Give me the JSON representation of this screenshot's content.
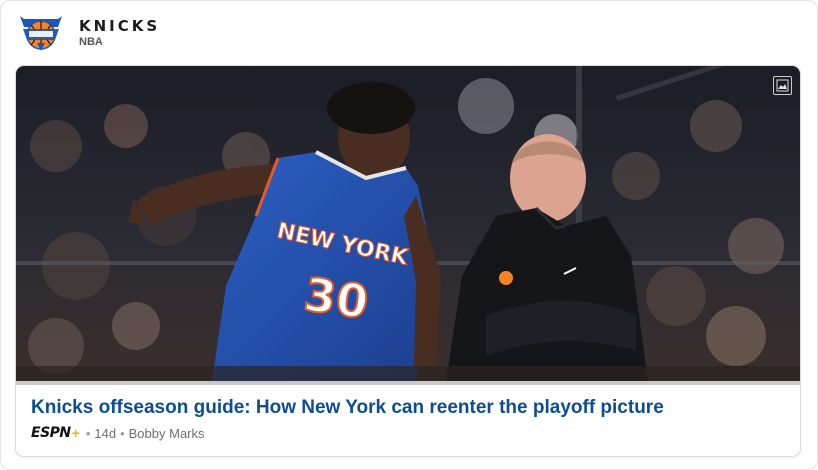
{
  "header": {
    "team_name": "KNICKS",
    "league": "NBA",
    "logo_icon": "knicks-logo",
    "colors": {
      "knicks_blue": "#1d57b6",
      "knicks_orange": "#f58426"
    }
  },
  "article": {
    "headline": "Knicks offseason guide: How New York can reenter the playoff picture",
    "source": "ESPN",
    "source_plus": "+",
    "separator": "•",
    "age": "14d",
    "author": "Bobby Marks",
    "image_icon": "image-icon",
    "jersey_text": "NEW YORK",
    "jersey_number": "30",
    "colors": {
      "headline": "#0e4d92",
      "meta": "#707070"
    }
  }
}
